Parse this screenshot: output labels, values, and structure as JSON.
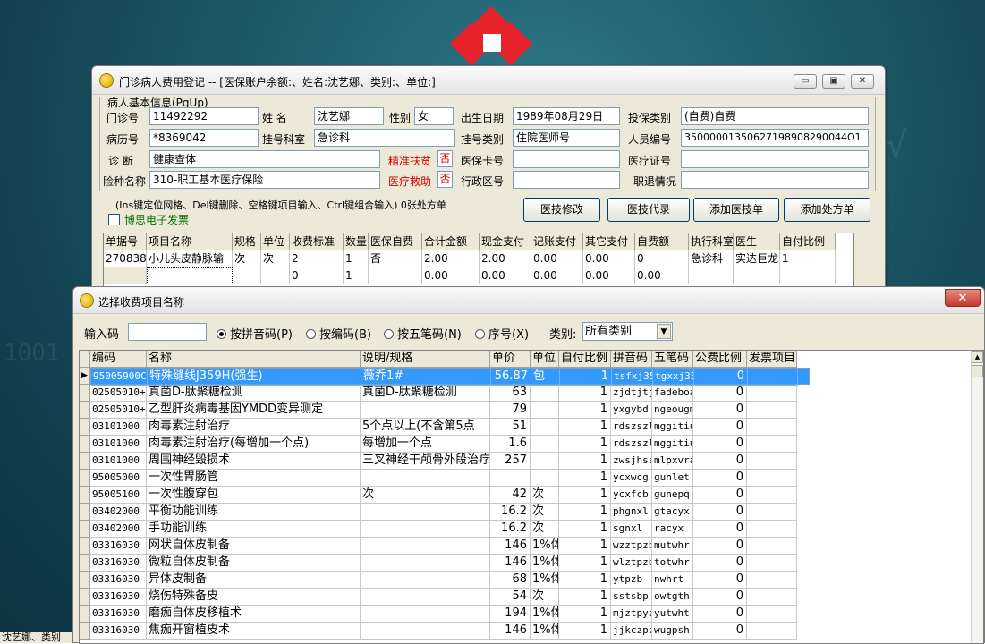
{
  "main_window": {
    "title": "门诊病人费用登记 -- [医保账户余额:、姓名:沈艺娜、类别:、单位:]",
    "buttons": {
      "minimize": "▭",
      "restore": "▣",
      "close": "✕"
    },
    "section_label": "病人基本信息(PgUp)",
    "fields": {
      "outpatient_no": {
        "label": "门诊号",
        "value": "11492292"
      },
      "name": {
        "label": "姓      名",
        "value": "沈艺娜"
      },
      "gender": {
        "label": "性别",
        "value": "女"
      },
      "birth": {
        "label": "出生日期",
        "value": "1989年08月29日"
      },
      "insure_type": {
        "label": "投保类别",
        "value": "(自费)自费"
      },
      "record_no": {
        "label": "病历号",
        "value": "*8369042"
      },
      "dept": {
        "label": "挂号科室",
        "value": "急诊科"
      },
      "reg_type": {
        "label": "挂号类别",
        "value": "住院医师号"
      },
      "staff_no": {
        "label": "人员编号",
        "value": "35000001350627198908290044O1"
      },
      "diagnosis": {
        "label": "诊    断",
        "value": "健康查体"
      },
      "poverty": {
        "label": "精准扶贫",
        "value": "否"
      },
      "card_no": {
        "label": "医保卡号",
        "value": ""
      },
      "cert_no": {
        "label": "医疗证号",
        "value": ""
      },
      "insurance": {
        "label": "险种名称",
        "value": "310-职工基本医疗保险"
      },
      "assist": {
        "label": "医疗救助",
        "value": "否"
      },
      "region": {
        "label": "行政区号",
        "value": ""
      },
      "retire": {
        "label": "职退情况",
        "value": ""
      }
    },
    "hint": "(Ins键定位网格、Del键删除、空格键项目输入、Ctrl键组合输入) 0张处方单",
    "checkbox_label": "博思电子发票",
    "action_buttons": [
      "医技修改",
      "医技代录",
      "添加医技单",
      "添加处方单"
    ],
    "grid": {
      "headers": [
        "单据号",
        "项目名称",
        "规格",
        "单位",
        "收费标准",
        "数量",
        "医保自费",
        "合计金额",
        "现金支付",
        "记账支付",
        "其它支付",
        "自费额",
        "执行科室",
        "医生",
        "自付比例"
      ],
      "rows": [
        [
          "2708380",
          "小儿头皮静脉输",
          "次",
          "次",
          "2",
          "1",
          "否",
          "2.00",
          "2.00",
          "0.00",
          "0.00",
          "0",
          "急诊科",
          "实达巨龙",
          "1"
        ],
        [
          "",
          "",
          "",
          "",
          "0",
          "1",
          "",
          "0.00",
          "0.00",
          "0.00",
          "0.00",
          "0.00",
          "",
          "",
          ""
        ]
      ]
    }
  },
  "select_window": {
    "title": "选择收费项目名称",
    "close": "✕",
    "input_label": "输入码",
    "input_value": "",
    "options": [
      {
        "label": "按拼音码(P)",
        "checked": true
      },
      {
        "label": "按编码(B)",
        "checked": false
      },
      {
        "label": "按五笔码(N)",
        "checked": false
      },
      {
        "label": "序号(X)",
        "checked": false
      }
    ],
    "category_label": "类别:",
    "category_value": "所有类别",
    "headers": [
      "编码",
      "名称",
      "说明/规格",
      "单价",
      "单位",
      "自付比例",
      "拼音码",
      "五笔码",
      "公费比例",
      "发票项目"
    ],
    "rows": [
      [
        "95005900C",
        "特殊缝线J359H(强生)",
        "薇乔1#",
        "56.87",
        "包",
        "1",
        "tsfxj359",
        "tgxxj359",
        "0",
        ""
      ],
      [
        "02505010+",
        "真菌D-肽聚糖检测",
        "真菌D-肽聚糖检测",
        "63",
        "",
        "1",
        "zjdtjtj",
        "fadeboa",
        "0",
        ""
      ],
      [
        "02505010+",
        "乙型肝炎病毒基因YMDD变异测定",
        "",
        "79",
        "",
        "1",
        "yxgybd",
        "ngeougm",
        "0",
        ""
      ],
      [
        "03101000",
        "肉毒素注射治疗",
        "5个点以上(不含第5点",
        "51",
        "",
        "1",
        "rdszszl",
        "mggitiu",
        "0",
        ""
      ],
      [
        "03101000",
        "肉毒素注射治疗(每增加一个点)",
        "每增加一个点",
        "1.6",
        "",
        "1",
        "rdszszl",
        "mggitiu",
        "0",
        ""
      ],
      [
        "03101000",
        "周围神经毁损术",
        "三叉神经干颅骨外段治疗",
        "257",
        "",
        "1",
        "zwsjhss",
        "mlpxvra",
        "0",
        ""
      ],
      [
        "95005000",
        "一次性胃肠管",
        "",
        "",
        "",
        "1",
        "ycxwcg",
        "gunlet",
        "0",
        ""
      ],
      [
        "95005100",
        "一次性腹穿包",
        "次",
        "42",
        "次",
        "1",
        "ycxfcb",
        "gunepq",
        "0",
        ""
      ],
      [
        "03402000",
        "平衡功能训练",
        "",
        "16.2",
        "次",
        "1",
        "phgnxl",
        "gtacyx",
        "0",
        ""
      ],
      [
        "03402000",
        "手功能训练",
        "",
        "16.2",
        "次",
        "1",
        "sgnxl",
        "racyx",
        "0",
        ""
      ],
      [
        "03316030",
        "网状自体皮制备",
        "",
        "146",
        "1%体",
        "1",
        "wzztpzb",
        "mutwhr",
        "0",
        ""
      ],
      [
        "03316030",
        "微粒自体皮制备",
        "",
        "146",
        "1%体",
        "1",
        "wlztpzb",
        "totwhr",
        "0",
        ""
      ],
      [
        "03316030",
        "异体皮制备",
        "",
        "68",
        "1%体",
        "1",
        "ytpzb",
        "nwhrt",
        "0",
        ""
      ],
      [
        "03316030",
        "烧伤特殊备皮",
        "",
        "54",
        "次",
        "1",
        "sstsbp",
        "owtgth",
        "0",
        ""
      ],
      [
        "03316030",
        "磨痂自体皮移植术",
        "",
        "194",
        "1%体",
        "1",
        "mjztpyz",
        "yutwht",
        "0",
        ""
      ],
      [
        "03316030",
        "焦痂开窗植皮术",
        "",
        "146",
        "1%体",
        "1",
        "jjkczpz",
        "wugpsh",
        "0",
        ""
      ]
    ]
  },
  "taskbar_fragment": "沈艺娜、类别"
}
